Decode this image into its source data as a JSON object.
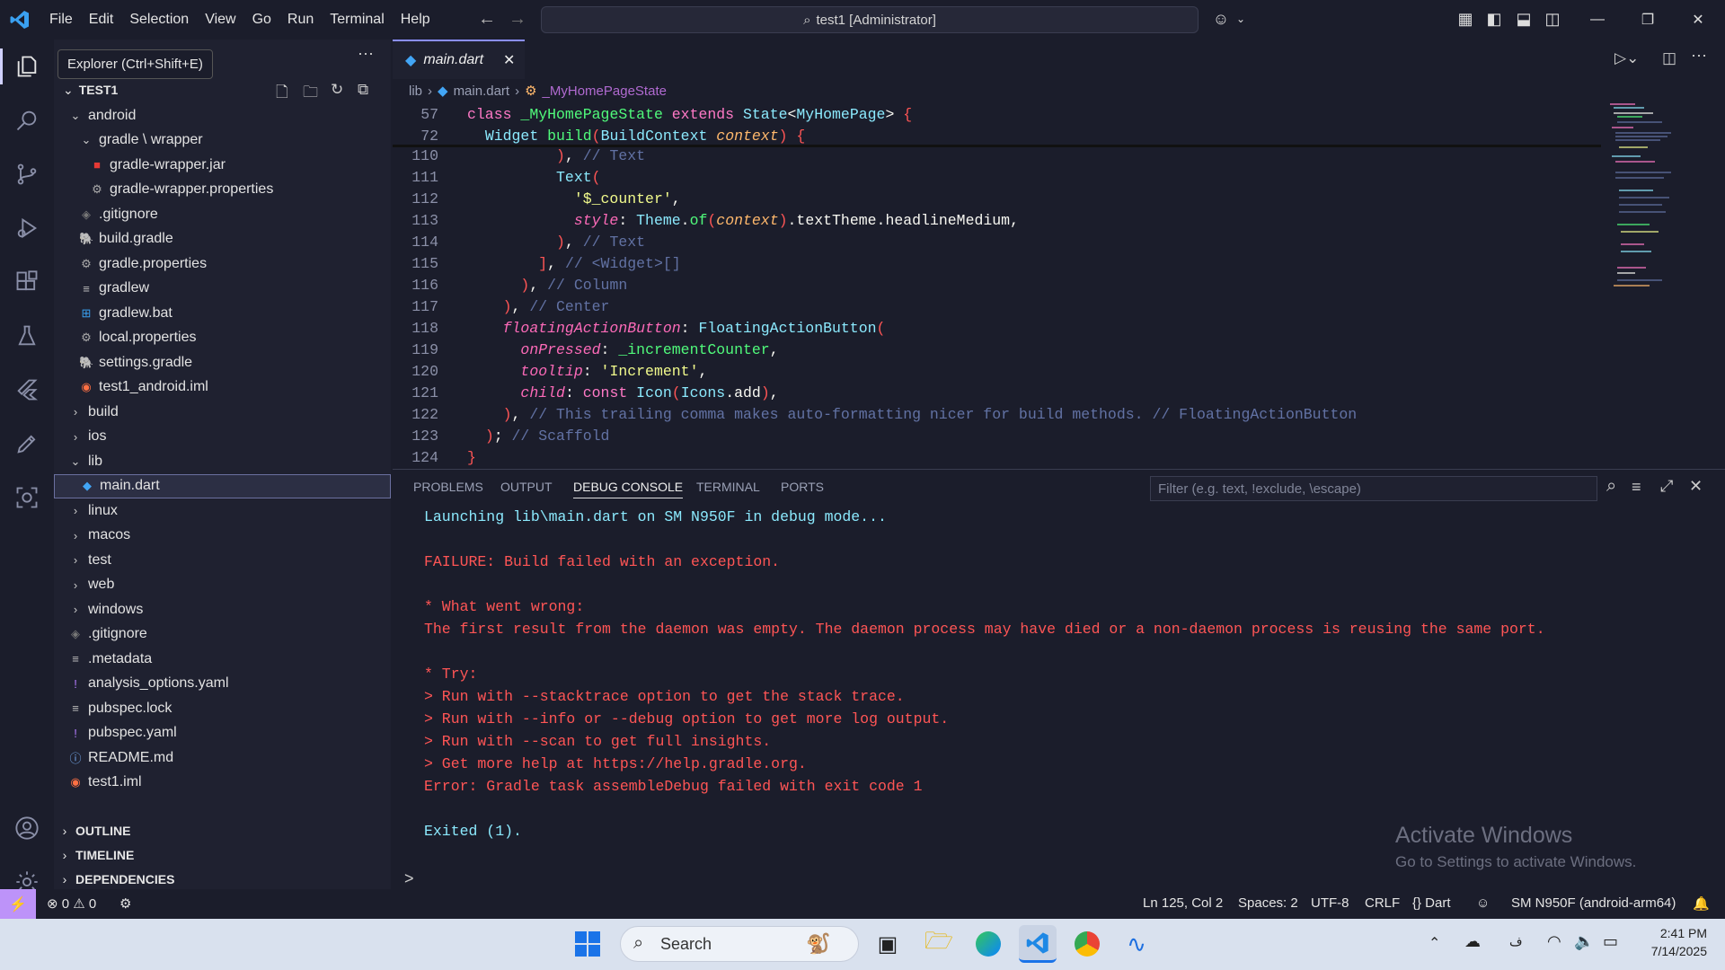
{
  "window": {
    "title": "test1 [Administrator]"
  },
  "menu": [
    "File",
    "Edit",
    "Selection",
    "View",
    "Go",
    "Run",
    "Terminal",
    "Help"
  ],
  "tooltip": "Explorer (Ctrl+Shift+E)",
  "explorer": {
    "root": "TEST1",
    "items": [
      {
        "label": "android",
        "icon": "chevron-down"
      },
      {
        "label": "gradle \\ wrapper",
        "icon": "chevron-down"
      },
      {
        "label": "gradle-wrapper.jar",
        "icon": "jar"
      },
      {
        "label": "gradle-wrapper.properties",
        "icon": "gear"
      },
      {
        "label": ".gitignore",
        "icon": "git"
      },
      {
        "label": "build.gradle",
        "icon": "gradle"
      },
      {
        "label": "gradle.properties",
        "icon": "gear"
      },
      {
        "label": "gradlew",
        "icon": "lines"
      },
      {
        "label": "gradlew.bat",
        "icon": "windows"
      },
      {
        "label": "local.properties",
        "icon": "gear"
      },
      {
        "label": "settings.gradle",
        "icon": "gradle"
      },
      {
        "label": "test1_android.iml",
        "icon": "rss"
      },
      {
        "label": "build",
        "icon": "chevron-right"
      },
      {
        "label": "ios",
        "icon": "chevron-right"
      },
      {
        "label": "lib",
        "icon": "chevron-down"
      },
      {
        "label": "main.dart",
        "icon": "dart"
      },
      {
        "label": "linux",
        "icon": "chevron-right"
      },
      {
        "label": "macos",
        "icon": "chevron-right"
      },
      {
        "label": "test",
        "icon": "chevron-right"
      },
      {
        "label": "web",
        "icon": "chevron-right"
      },
      {
        "label": "windows",
        "icon": "chevron-right"
      },
      {
        "label": ".gitignore",
        "icon": "git"
      },
      {
        "label": ".metadata",
        "icon": "lines"
      },
      {
        "label": "analysis_options.yaml",
        "icon": "exclaim"
      },
      {
        "label": "pubspec.lock",
        "icon": "lines"
      },
      {
        "label": "pubspec.yaml",
        "icon": "exclaim"
      },
      {
        "label": "README.md",
        "icon": "info"
      },
      {
        "label": "test1.iml",
        "icon": "rss"
      }
    ],
    "sections": [
      "OUTLINE",
      "TIMELINE",
      "DEPENDENCIES"
    ]
  },
  "editor": {
    "tab": "main.dart",
    "breadcrumb": [
      "lib",
      "main.dart",
      "_MyHomePageState"
    ],
    "sticky": [
      {
        "ln": "57",
        "code": "class _MyHomePageState extends State<MyHomePage> {"
      },
      {
        "ln": "72",
        "code": "  Widget build(BuildContext context) {"
      }
    ],
    "lines": [
      {
        "ln": "110",
        "code": "          ), // Text"
      },
      {
        "ln": "111",
        "code": "          Text("
      },
      {
        "ln": "112",
        "code": "            '$_counter',"
      },
      {
        "ln": "113",
        "code": "            style: Theme.of(context).textTheme.headlineMedium,"
      },
      {
        "ln": "114",
        "code": "          ), // Text"
      },
      {
        "ln": "115",
        "code": "        ], // <Widget>[]"
      },
      {
        "ln": "116",
        "code": "      ), // Column"
      },
      {
        "ln": "117",
        "code": "    ), // Center"
      },
      {
        "ln": "118",
        "code": "    floatingActionButton: FloatingActionButton("
      },
      {
        "ln": "119",
        "code": "      onPressed: _incrementCounter,"
      },
      {
        "ln": "120",
        "code": "      tooltip: 'Increment',"
      },
      {
        "ln": "121",
        "code": "      child: const Icon(Icons.add),"
      },
      {
        "ln": "122",
        "code": "    ), // This trailing comma makes auto-formatting nicer for build methods. // FloatingActionButton"
      },
      {
        "ln": "123",
        "code": "  ); // Scaffold"
      },
      {
        "ln": "124",
        "code": "}"
      }
    ]
  },
  "panel": {
    "tabs": [
      "PROBLEMS",
      "OUTPUT",
      "DEBUG CONSOLE",
      "TERMINAL",
      "PORTS"
    ],
    "active_tab": "DEBUG CONSOLE",
    "filter_placeholder": "Filter (e.g. text, !exclude, \\escape)",
    "console": [
      {
        "text": "Launching lib\\main.dart on SM N950F in debug mode...",
        "color": "blue"
      },
      {
        "text": "",
        "color": "red"
      },
      {
        "text": "FAILURE: Build failed with an exception.",
        "color": "red"
      },
      {
        "text": "",
        "color": "red"
      },
      {
        "text": "* What went wrong:",
        "color": "red"
      },
      {
        "text": "The first result from the daemon was empty. The daemon process may have died or a non-daemon process is reusing the same port.",
        "color": "red"
      },
      {
        "text": "",
        "color": "red"
      },
      {
        "text": "* Try:",
        "color": "red"
      },
      {
        "text": "> Run with --stacktrace option to get the stack trace.",
        "color": "red"
      },
      {
        "text": "> Run with --info or --debug option to get more log output.",
        "color": "red"
      },
      {
        "text": "> Run with --scan to get full insights.",
        "color": "red"
      },
      {
        "text": "> Get more help at https://help.gradle.org.",
        "color": "red"
      },
      {
        "text": "Error: Gradle task assembleDebug failed with exit code 1",
        "color": "red"
      },
      {
        "text": "",
        "color": "red"
      },
      {
        "text": "Exited (1).",
        "color": "blue"
      }
    ],
    "prompt": ">"
  },
  "watermark": {
    "title": "Activate Windows",
    "subtitle": "Go to Settings to activate Windows."
  },
  "status": {
    "errors": "0",
    "warnings": "0",
    "cursor": "Ln 125, Col 2",
    "spaces": "Spaces: 2",
    "encoding": "UTF-8",
    "eol": "CRLF",
    "language": "{} Dart",
    "device": "SM N950F (android-arm64)"
  },
  "taskbar": {
    "search": "Search",
    "time": "2:41 PM",
    "date": "7/14/2025"
  },
  "colors": {
    "accent": "#bd93f9",
    "error": "#ff5555",
    "info": "#8be9fd"
  }
}
